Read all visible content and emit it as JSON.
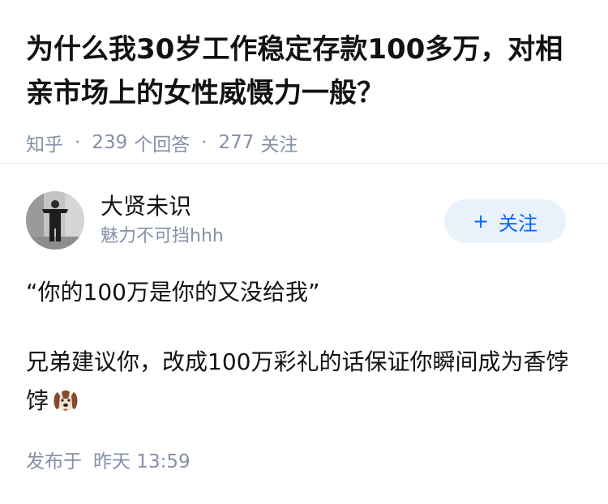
{
  "question": {
    "title": "为什么我30岁工作稳定存款100多万，对相亲市场上的女性威慑力一般？",
    "source": "知乎",
    "separator": "·",
    "answer_count": "239",
    "answer_label": "个回答",
    "follower_count": "277",
    "follower_label": "关注"
  },
  "author": {
    "name": "大贤未识",
    "headline": "魅力不可挡hhh",
    "follow_plus": "+",
    "follow_label": "关注"
  },
  "answer": {
    "paragraph1": "“你的100万是你的又没给我”",
    "paragraph2": "兄弟建议你，改成100万彩礼的话保证你瞬间成为香饽饽",
    "emoji": "dog-face-emoji"
  },
  "footer": {
    "published_label": "发布于",
    "published_time": "昨天 13:59"
  },
  "colors": {
    "accent": "#0066ff",
    "follow_bg": "#e9f2fb",
    "meta": "#8590a6",
    "text": "#121212"
  }
}
